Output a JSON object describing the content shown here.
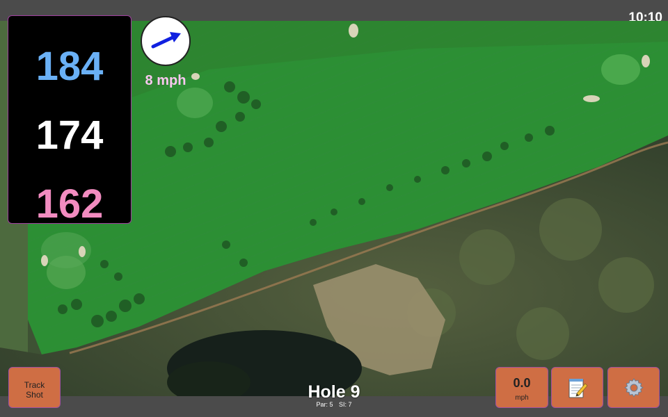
{
  "status_bar": {
    "time": "10:10"
  },
  "distances": {
    "back": "184",
    "center": "174",
    "front": "162"
  },
  "wind": {
    "speed_label": "8 mph",
    "direction": "arrow pointing up-right"
  },
  "hole": {
    "title": "Hole 9",
    "par": "Par: 5",
    "si": "SI: 7"
  },
  "buttons": {
    "track_shot": [
      "Track",
      "Shot"
    ],
    "speed_value": "0.0",
    "speed_unit": "mph",
    "notes_icon": "notepad-pencil-icon",
    "settings_icon": "gear-icon"
  },
  "colors": {
    "back": "#6ab0f5",
    "center": "#ffffff",
    "front": "#f28cc0",
    "wind_text": "#f9c8f0",
    "button": "#cf6e44",
    "wind_arrow": "#1020e0"
  }
}
